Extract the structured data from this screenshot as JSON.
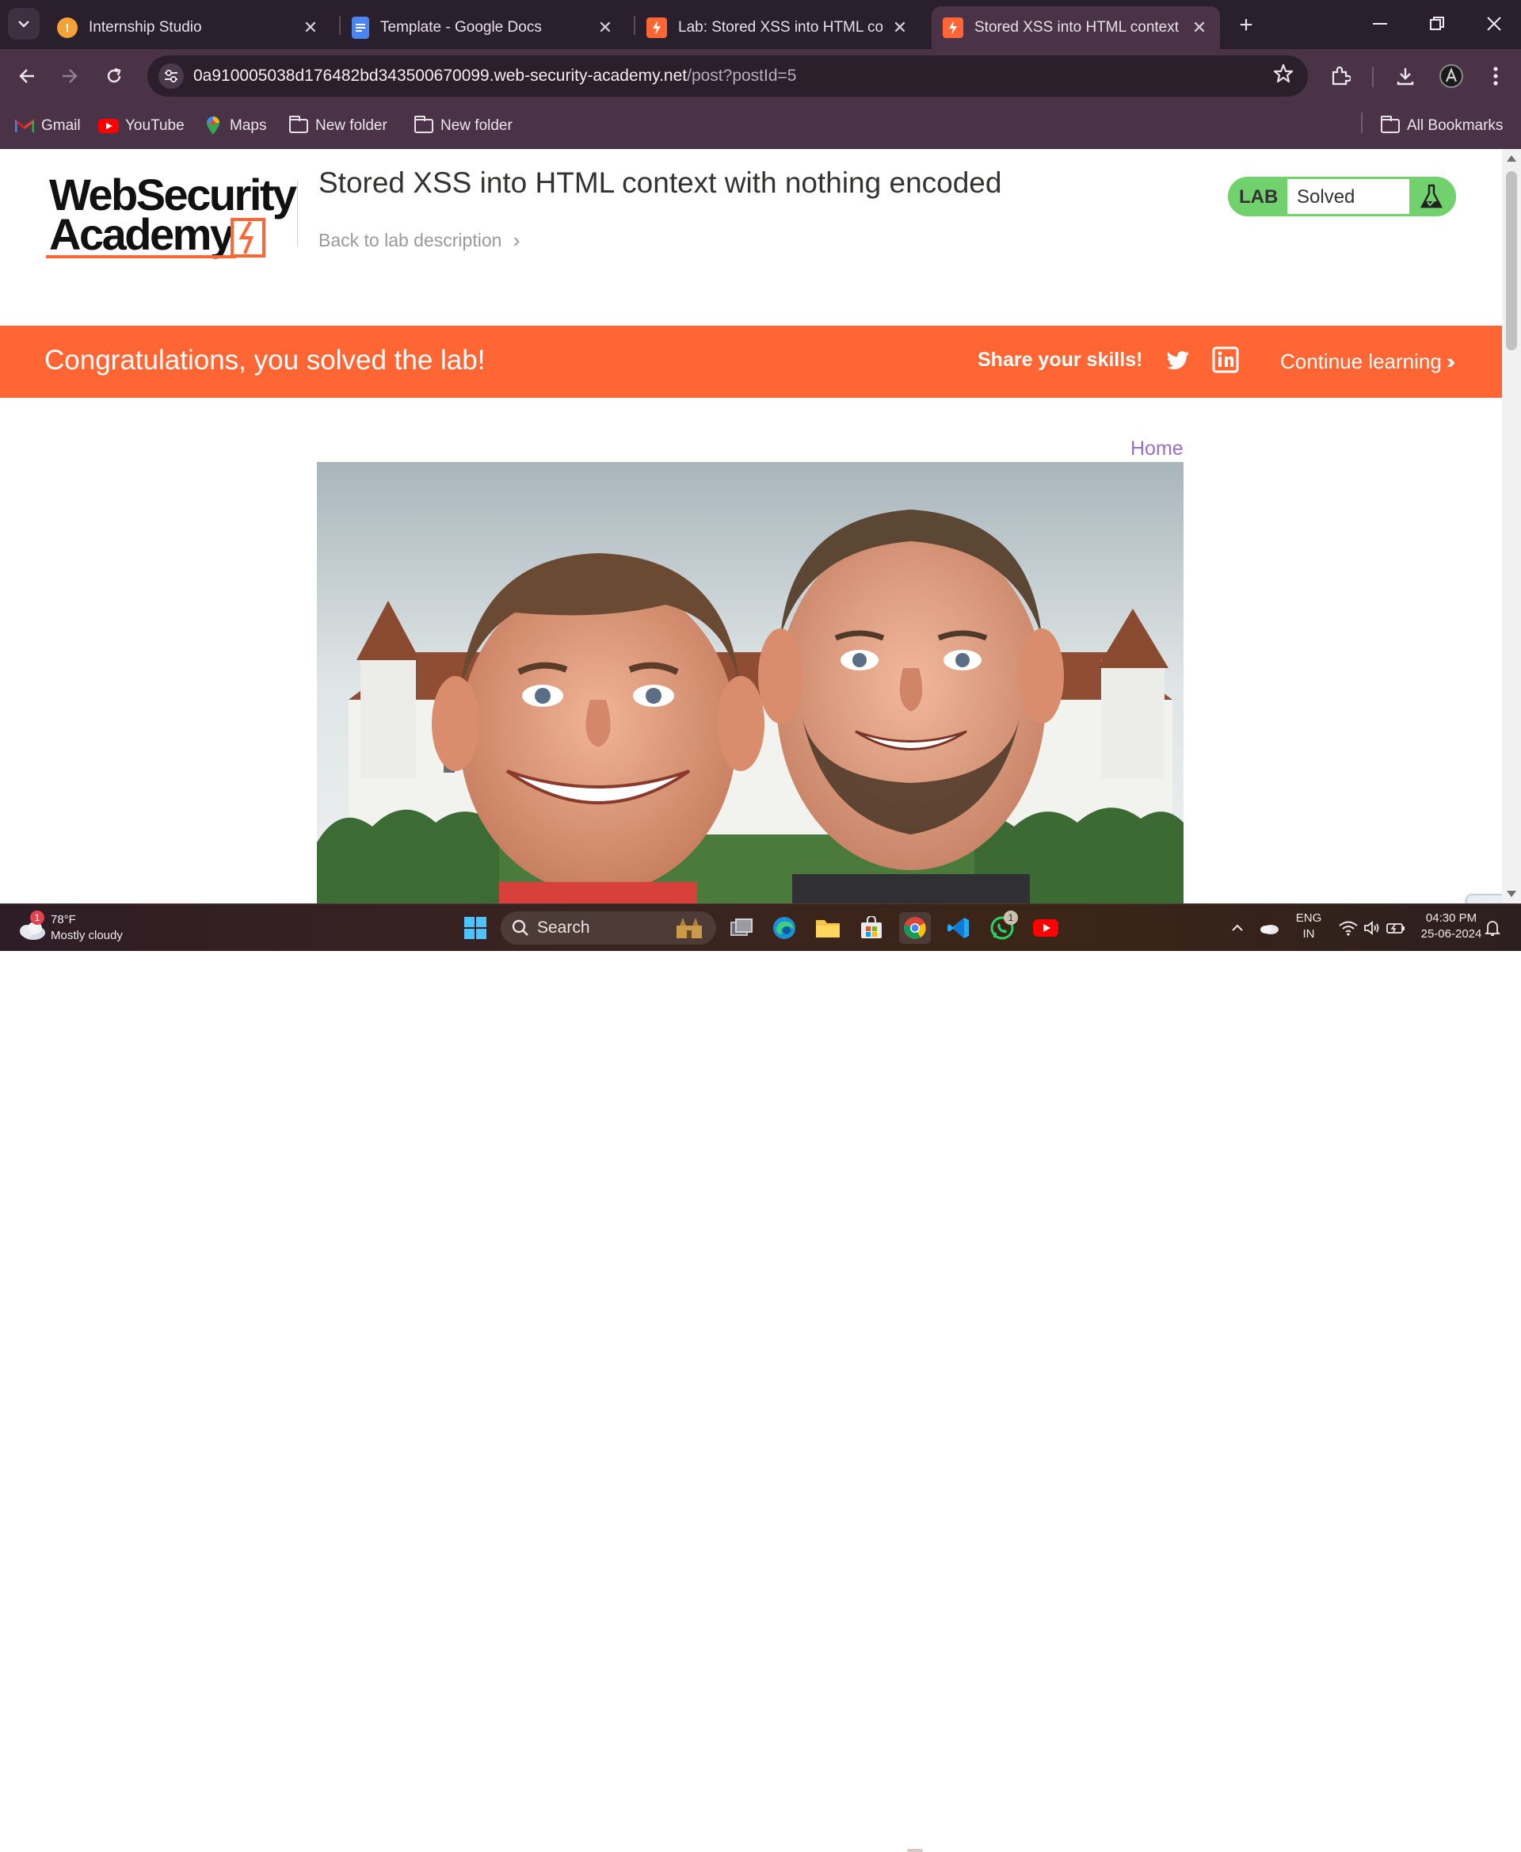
{
  "browser": {
    "tabs": [
      {
        "title": "Internship Studio",
        "favicon": "internship-studio-icon",
        "active": false
      },
      {
        "title": "Template - Google Docs",
        "favicon": "google-docs-icon",
        "active": false
      },
      {
        "title": "Lab: Stored XSS into HTML cont",
        "favicon": "portswigger-icon",
        "active": false
      },
      {
        "title": "Stored XSS into HTML context w",
        "favicon": "portswigger-icon",
        "active": true
      }
    ],
    "url_host": "0a910005038d176482bd343500670099.web-security-academy.net",
    "url_path": "/post?postId=5",
    "bookmarks": [
      {
        "label": "Gmail",
        "icon": "gmail-icon"
      },
      {
        "label": "YouTube",
        "icon": "youtube-icon"
      },
      {
        "label": "Maps",
        "icon": "maps-icon"
      },
      {
        "label": "New folder",
        "icon": "folder-icon"
      },
      {
        "label": "New folder",
        "icon": "folder-icon"
      }
    ],
    "all_bookmarks": "All Bookmarks"
  },
  "page": {
    "logo_line1": "WebSecurity",
    "logo_line2": "Academy",
    "lab_title": "Stored XSS into HTML context with nothing encoded",
    "back_link": "Back to lab description",
    "lab_badge": "LAB",
    "lab_status": "Solved",
    "banner": {
      "congrats": "Congratulations, you solved the lab!",
      "share": "Share your skills!",
      "continue": "Continue learning"
    },
    "home_link": "Home",
    "colors": {
      "accent": "#ff6633",
      "solved_green": "#70d16d",
      "link_purple": "#9a6fbf"
    }
  },
  "taskbar": {
    "weather_temp": "78°F",
    "weather_desc": "Mostly cloudy",
    "weather_badge": "1",
    "search_label": "Search",
    "whatsapp_badge": "1",
    "lang_line1": "ENG",
    "lang_line2": "IN",
    "time": "04:30 PM",
    "date": "25-06-2024"
  }
}
